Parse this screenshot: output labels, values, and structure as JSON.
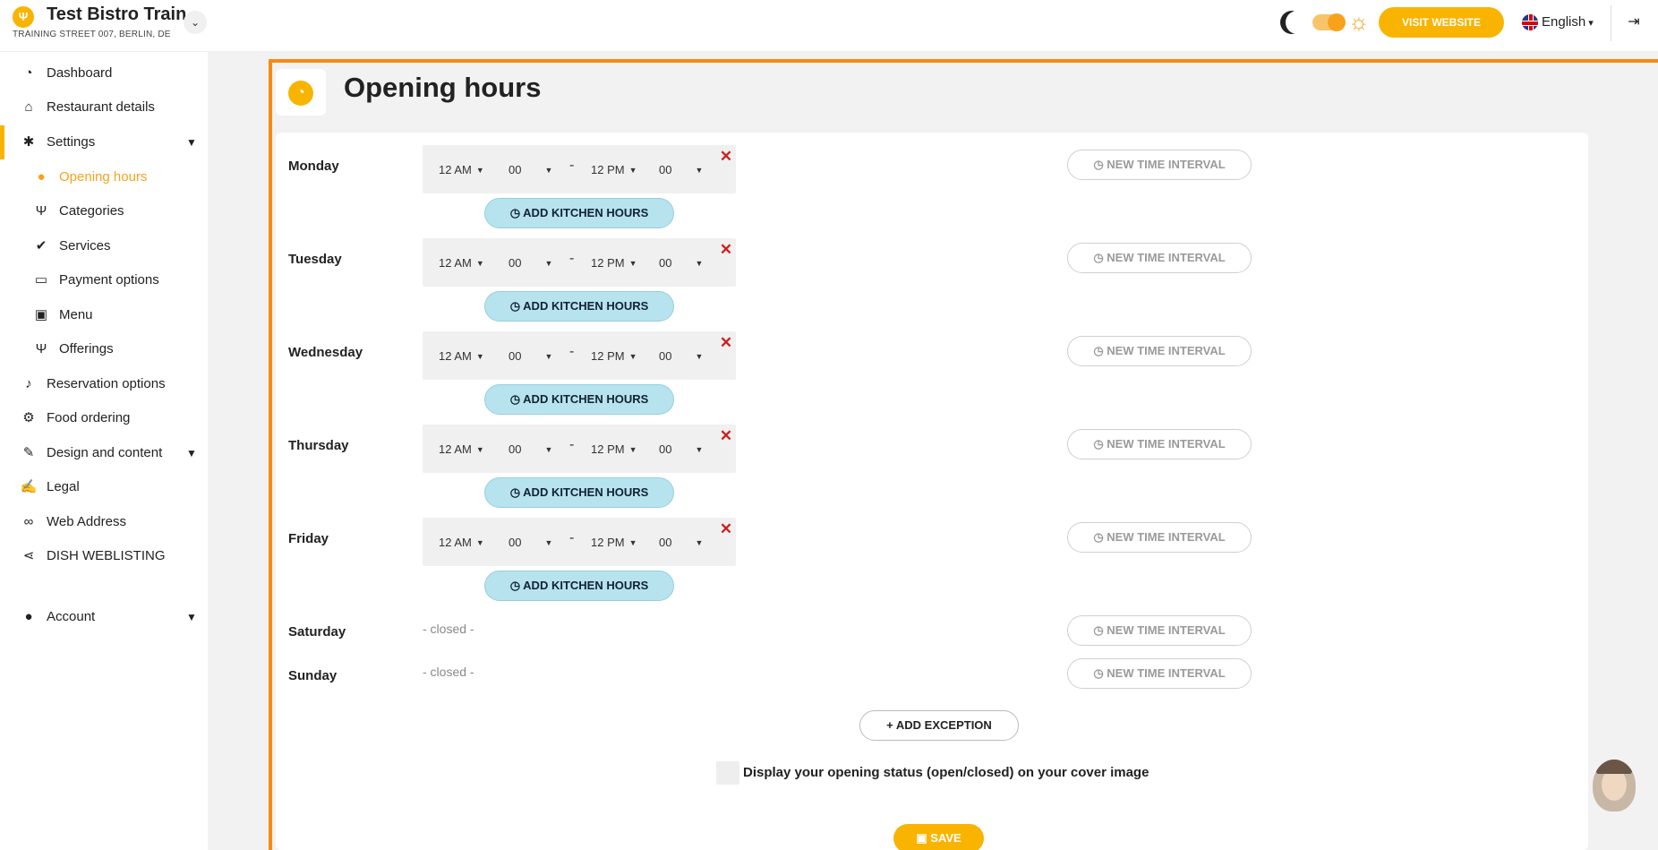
{
  "header": {
    "restaurant_name": "Test Bistro Train..",
    "restaurant_address": "TRAINING STREET 007, BERLIN, DE",
    "visit_website_label": "VISIT WEBSITE",
    "language": "English"
  },
  "sidebar": {
    "items": [
      {
        "label": "Dashboard",
        "icon": "dashboard-icon"
      },
      {
        "label": "Restaurant details",
        "icon": "home-icon"
      },
      {
        "label": "Settings",
        "icon": "gear-icon"
      },
      {
        "label": "Opening hours",
        "icon": "clock-icon"
      },
      {
        "label": "Categories",
        "icon": "cutlery-icon"
      },
      {
        "label": "Services",
        "icon": "check-circle-icon"
      },
      {
        "label": "Payment options",
        "icon": "credit-card-icon"
      },
      {
        "label": "Menu",
        "icon": "menu-icon"
      },
      {
        "label": "Offerings",
        "icon": "cutlery-icon"
      },
      {
        "label": "Reservation options",
        "icon": "bell-icon"
      },
      {
        "label": "Food ordering",
        "icon": "food-ordering-icon"
      },
      {
        "label": "Design and content",
        "icon": "brush-icon"
      },
      {
        "label": "Legal",
        "icon": "legal-icon"
      },
      {
        "label": "Web Address",
        "icon": "link-icon"
      },
      {
        "label": "DISH WEBLISTING",
        "icon": "share-icon"
      },
      {
        "label": "Account",
        "icon": "user-icon"
      }
    ]
  },
  "main": {
    "title": "Opening hours",
    "days": [
      {
        "name": "Monday",
        "start_hour": "12 AM",
        "start_min": "00",
        "end_hour": "12 PM",
        "end_min": "00"
      },
      {
        "name": "Tuesday",
        "start_hour": "12 AM",
        "start_min": "00",
        "end_hour": "12 PM",
        "end_min": "00"
      },
      {
        "name": "Wednesday",
        "start_hour": "12 AM",
        "start_min": "00",
        "end_hour": "12 PM",
        "end_min": "00"
      },
      {
        "name": "Thursday",
        "start_hour": "12 AM",
        "start_min": "00",
        "end_hour": "12 PM",
        "end_min": "00"
      },
      {
        "name": "Friday",
        "start_hour": "12 AM",
        "start_min": "00",
        "end_hour": "12 PM",
        "end_min": "00"
      },
      {
        "name": "Saturday",
        "closed_text": "- closed -"
      },
      {
        "name": "Sunday",
        "closed_text": "- closed -"
      }
    ],
    "separator": "-",
    "add_kitchen_hours_label": "ADD KITCHEN HOURS",
    "new_time_interval_label": "NEW TIME INTERVAL",
    "add_exception_label": "ADD EXCEPTION",
    "display_status_label": "Display your opening status (open/closed) on your cover image",
    "save_label": "SAVE"
  },
  "colors": {
    "accent": "#f8b400",
    "frame": "#f88a12",
    "kitchen_button": "#b7e3ee",
    "remove": "#cc1f1f"
  }
}
